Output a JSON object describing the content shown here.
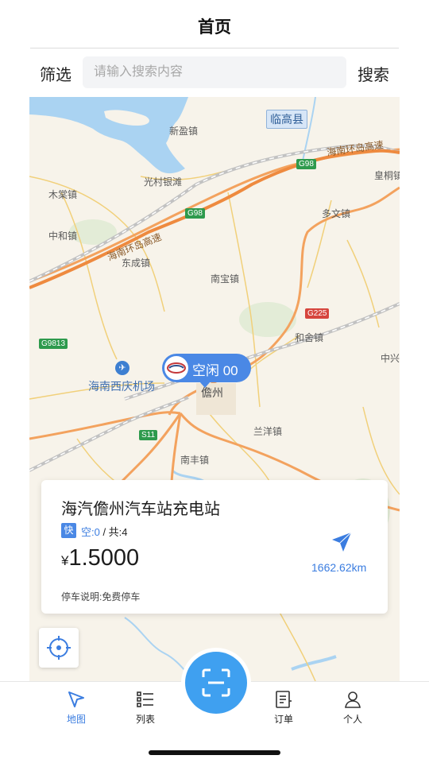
{
  "header": {
    "title": "首页"
  },
  "search": {
    "filter_label": "筛选",
    "placeholder": "请输入搜索内容",
    "search_label": "搜索"
  },
  "map": {
    "county_tag": "临高县",
    "place_labels": [
      "新盈镇",
      "光村银滩",
      "木棠镇",
      "中和镇",
      "东成镇",
      "南宝镇",
      "多文镇",
      "皇桐镇",
      "和舍镇",
      "中兴",
      "兰洋镇",
      "南丰镇",
      "儋州"
    ],
    "expressway_labels": [
      "海南环岛高速",
      "海南环岛高速"
    ],
    "road_badges": [
      "G98",
      "G98",
      "G9813",
      "G225",
      "S11"
    ],
    "airport_label": "海南西庆机场",
    "marker_text": "空闲 00"
  },
  "station": {
    "name": "海汽儋州汽车站充电站",
    "fast_label": "快",
    "free_text": "空:0",
    "total_text": " / 共:4",
    "currency": "¥",
    "price": "1.5000",
    "parking_note": "停车说明:免费停车",
    "distance": "1662.62km"
  },
  "tabs": [
    {
      "label": "地图",
      "icon": "navigation-icon",
      "active": true
    },
    {
      "label": "列表",
      "icon": "list-icon",
      "active": false
    },
    {
      "label": "订单",
      "icon": "order-icon",
      "active": false
    },
    {
      "label": "个人",
      "icon": "person-icon",
      "active": false
    }
  ],
  "colors": {
    "accent": "#3b7de0",
    "scan": "#3fa0f0",
    "marker": "#4a88e5"
  }
}
